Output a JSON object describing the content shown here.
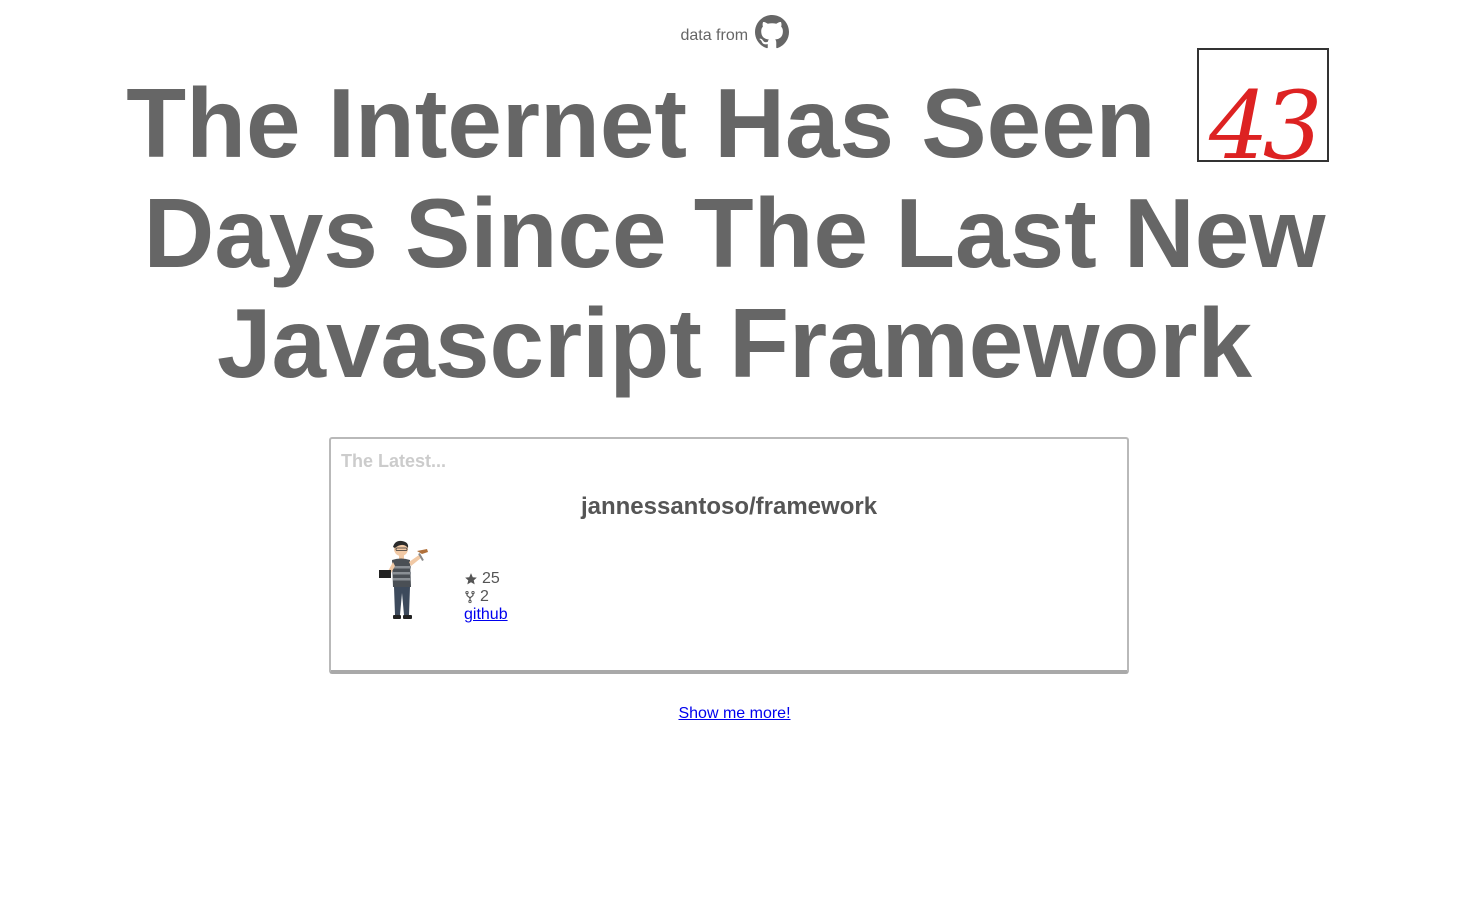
{
  "header": {
    "source_label": "data from",
    "source_icon": "github-icon"
  },
  "headline": {
    "before": "The Internet Has Seen",
    "days_count": "43",
    "after": "Days Since The Last New Javascript Framework"
  },
  "latest_card": {
    "heading": "The Latest...",
    "repo_name": "jannessantoso/framework",
    "avatar_icon": "user-avatar",
    "stars": "25",
    "star_icon": "star-icon",
    "forks": "2",
    "fork_icon": "fork-icon",
    "link_label": "github"
  },
  "footer": {
    "more_label": "Show me more!"
  },
  "colors": {
    "text": "#666666",
    "counter": "#dd2222",
    "link": "#0000ee",
    "latest_heading": "#cccccc"
  }
}
